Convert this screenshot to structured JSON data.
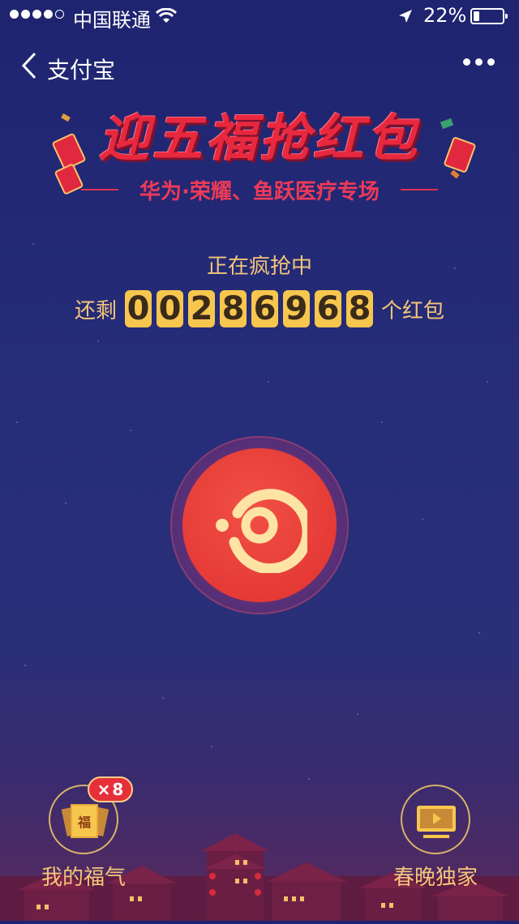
{
  "status_bar": {
    "carrier": "中国联通",
    "battery_text": "22%",
    "battery_level": 0.22,
    "signal_bars_filled": 4,
    "signal_bars_total": 5
  },
  "nav": {
    "back_label": "支付宝",
    "more_icon": "more-dots-icon"
  },
  "banner": {
    "title": "迎五福抢红包",
    "subtitle": "华为·荣耀、鱼跃医疗专场"
  },
  "counter": {
    "status": "正在疯抢中",
    "prefix": "还剩",
    "digits": [
      "0",
      "0",
      "2",
      "8",
      "6",
      "9",
      "6",
      "8"
    ],
    "suffix": "个红包"
  },
  "main_button": {
    "icon": "grab-red-packet-icon"
  },
  "bottom": {
    "my_fu": {
      "label": "我的福气",
      "card_char": "福",
      "badge_symbol": "×",
      "badge_count": "8"
    },
    "gala": {
      "label": "春晚独家",
      "icon": "tv-play-icon"
    }
  },
  "colors": {
    "background": "#262d79",
    "accent_red": "#e53a36",
    "gold": "#f7c64e",
    "gold_text": "#f3c57a"
  }
}
